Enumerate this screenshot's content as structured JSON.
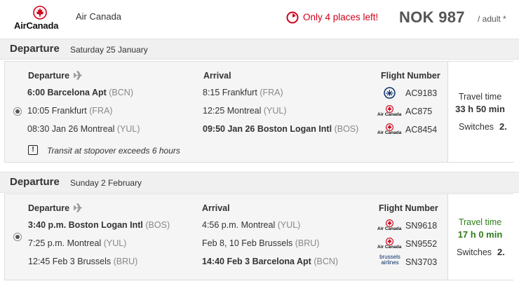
{
  "header": {
    "logo_text": "AirCanada",
    "airline_name": "Air Canada",
    "alert_text": "Only 4 places left!",
    "price": "NOK 987",
    "per_adult": "/ adult *"
  },
  "columns": {
    "departure": "Departure",
    "arrival": "Arrival",
    "flight_number": "Flight Number"
  },
  "outbound": {
    "title": "Departure",
    "date": "Saturday 25 January",
    "segments": [
      {
        "dep_time": "6:00 Barcelona Apt",
        "dep_code": "(BCN)",
        "arr_time": "8:15 Frankfurt",
        "arr_code": "(FRA)",
        "logo": "lufthansa",
        "flight": "AC9183"
      },
      {
        "dep_time": "10:05 Frankfurt",
        "dep_code": "(FRA)",
        "arr_time": "12:25 Montreal",
        "arr_code": "(YUL)",
        "logo": "aircanada",
        "flight": "AC875"
      },
      {
        "dep_time": "08:30 Jan 26 Montreal",
        "dep_code": "(YUL)",
        "arr_time": "09:50 Jan 26 Boston Logan Intl",
        "arr_code": "(BOS)",
        "logo": "aircanada",
        "flight": "AC8454"
      }
    ],
    "warning": "Transit at stopover exceeds 6 hours",
    "travel_label": "Travel time",
    "travel_value": "33 h 50 min",
    "switches_label": "Switches",
    "switches_value": "2."
  },
  "inbound": {
    "title": "Departure",
    "date": "Sunday 2 February",
    "segments": [
      {
        "dep_time": "3:40 p.m. Boston Logan Intl",
        "dep_code": "(BOS)",
        "arr_time": "4:56 p.m. Montreal",
        "arr_code": "(YUL)",
        "logo": "aircanada",
        "flight": "SN9618"
      },
      {
        "dep_time": "7:25 p.m. Montreal",
        "dep_code": "(YUL)",
        "arr_time": "Feb 8, 10 Feb Brussels",
        "arr_code": "(BRU)",
        "logo": "aircanada",
        "flight": "SN9552"
      },
      {
        "dep_time": "12:45 Feb 3 Brussels",
        "dep_code": "(BRU)",
        "arr_time": "14:40 Feb 3 Barcelona Apt",
        "arr_code": "(BCN)",
        "logo": "brussels",
        "flight": "SN3703"
      }
    ],
    "travel_label": "Travel time",
    "travel_value": "17 h 0 min",
    "switches_label": "Switches",
    "switches_value": "2."
  },
  "mini_logos": {
    "aircanada": "Air Canada",
    "brussels_line1": "brussels",
    "brussels_line2": "airlines"
  },
  "colors": {
    "brand_red": "#d0021b",
    "green": "#2e7d1a",
    "lufthansa_blue": "#0a2f6b"
  }
}
